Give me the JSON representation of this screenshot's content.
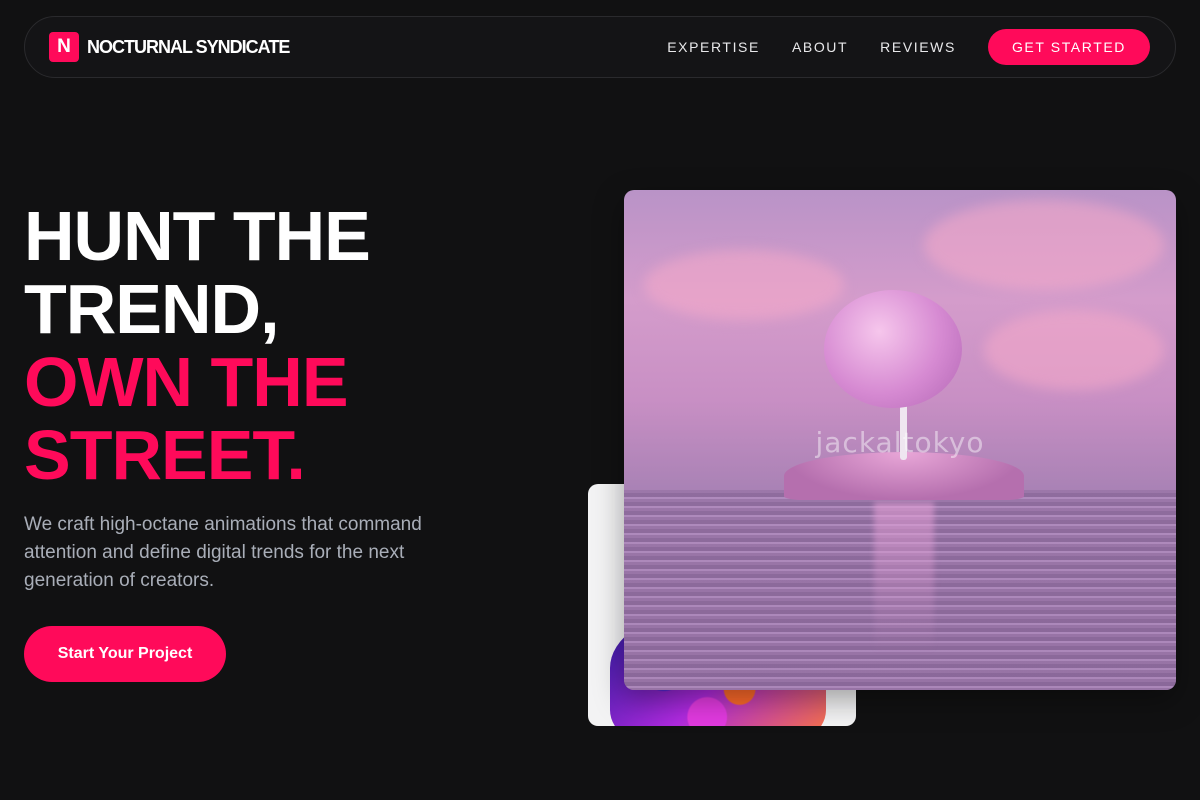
{
  "brand": {
    "mark": "N",
    "name": "NOCTURNAL SYNDICATE"
  },
  "nav": {
    "links": [
      "EXPERTISE",
      "ABOUT",
      "REVIEWS"
    ],
    "cta": "GET STARTED"
  },
  "hero": {
    "headline_white": [
      "HUNT THE",
      "TREND,"
    ],
    "headline_pink": [
      "OWN THE",
      "STREET."
    ],
    "subtitle": "We craft high-octane animations that command attention and define digital trends for the next generation of creators.",
    "cta": "Start Your Project"
  },
  "media": {
    "front_image_watermark": "jackaltokyo",
    "front_image_subject": "pink-tree-island",
    "back_image_subject": "iridescent-sculpture"
  },
  "colors": {
    "background": "#111112",
    "accent": "#ff0a5a",
    "text": "#ffffff",
    "muted_text": "#a9aeb8"
  }
}
